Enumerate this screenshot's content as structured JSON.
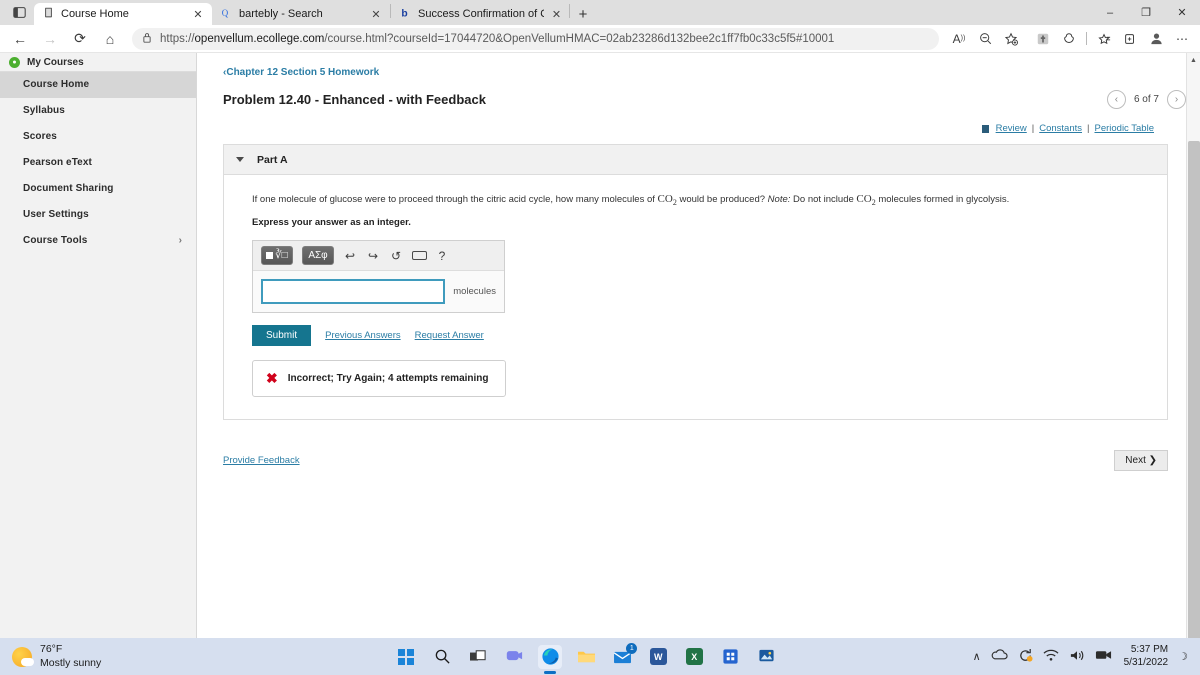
{
  "browser": {
    "tabs": [
      {
        "title": "Course Home",
        "icon": "page-icon",
        "active": true
      },
      {
        "title": "bartebly - Search",
        "icon": "search-icon",
        "active": false
      },
      {
        "title": "Success Confirmation of Questio",
        "icon": "bartleby-b-icon",
        "active": false
      }
    ],
    "new_tab_label": "+",
    "window_controls": {
      "minimize": "–",
      "maximize": "❐",
      "close": "✕"
    },
    "nav": {
      "back": "←",
      "forward": "→",
      "refresh": "⟳",
      "home": "⌂"
    },
    "url_prefix": "https://",
    "url_host": "openvellum.ecollege.com",
    "url_path": "/course.html?courseId=17044720&OpenVellumHMAC=02ab23286d132bee2c1ff7fb0c33c5f5#10001",
    "lock_icon": "🔒",
    "toolbar_icons": [
      "read-aloud-icon",
      "zoom-out-icon",
      "add-favorite-icon",
      "extension-icon",
      "browser-essentials-icon",
      "favorites-icon",
      "collections-icon",
      "profile-icon",
      "settings-more-icon"
    ]
  },
  "sidebar": {
    "my_courses": "My Courses",
    "items": [
      {
        "label": "Course Home",
        "active": true,
        "chevron": ""
      },
      {
        "label": "Syllabus",
        "active": false,
        "chevron": ""
      },
      {
        "label": "Scores",
        "active": false,
        "chevron": ""
      },
      {
        "label": "Pearson eText",
        "active": false,
        "chevron": ""
      },
      {
        "label": "Document Sharing",
        "active": false,
        "chevron": ""
      },
      {
        "label": "User Settings",
        "active": false,
        "chevron": ""
      },
      {
        "label": "Course Tools",
        "active": false,
        "chevron": "›"
      }
    ]
  },
  "main": {
    "breadcrumb": "Chapter 12 Section 5 Homework",
    "breadcrumb_carat": "‹",
    "problem_title": "Problem 12.40 - Enhanced - with Feedback",
    "pager": {
      "prev": "‹",
      "next": "›",
      "text": "6 of 7"
    },
    "reference_links": {
      "review": "Review",
      "constants": "Constants",
      "periodic_table": "Periodic Table",
      "separator": "|"
    },
    "part_label": "Part A",
    "question_part1": "If one molecule of glucose were to proceed through the citric acid cycle, how many molecules of ",
    "question_co2_a": "CO",
    "question_sub_a": "2",
    "question_part2": " would be produced? ",
    "question_note_italic": "Note:",
    "question_part3": " Do not include ",
    "question_co2_b": "CO",
    "question_sub_b": "2",
    "question_part4": " molecules formed in glycolysis.",
    "express_instruction": "Express your answer as an integer.",
    "math_toolbar": {
      "template_button": "template-icon",
      "greek_button": "ΑΣφ",
      "undo": "↩",
      "redo": "↪",
      "reset": "↺",
      "keyboard": "keyboard-icon",
      "help": "?"
    },
    "answer_value": "",
    "answer_units": "molecules",
    "submit_label": "Submit",
    "previous_answers_label": "Previous Answers",
    "request_answer_label": "Request Answer",
    "feedback": {
      "icon": "✖",
      "text": "Incorrect; Try Again; 4 attempts remaining"
    },
    "provide_feedback_label": "Provide Feedback",
    "next_label": "Next ❯"
  },
  "taskbar": {
    "weather_temp": "76°F",
    "weather_desc": "Mostly sunny",
    "apps": [
      {
        "name": "start-button",
        "glyph": ""
      },
      {
        "name": "search-icon",
        "glyph": "⚲"
      },
      {
        "name": "task-view-icon",
        "glyph": ""
      },
      {
        "name": "teams-icon",
        "glyph": ""
      },
      {
        "name": "edge-icon",
        "glyph": ""
      },
      {
        "name": "file-explorer-icon",
        "glyph": ""
      },
      {
        "name": "mail-icon",
        "glyph": "",
        "badge": "1"
      },
      {
        "name": "word-icon",
        "glyph": "W"
      },
      {
        "name": "excel-icon",
        "glyph": "X"
      },
      {
        "name": "microsoft-store-icon",
        "glyph": ""
      },
      {
        "name": "photos-icon",
        "glyph": ""
      }
    ],
    "tray": {
      "chevron": "∧",
      "onedrive": "☁",
      "update": "↻",
      "wifi": "◠",
      "volume": "🔊",
      "battery": "📹",
      "time": "5:37 PM",
      "date": "5/31/2022",
      "notification": "☽"
    }
  }
}
